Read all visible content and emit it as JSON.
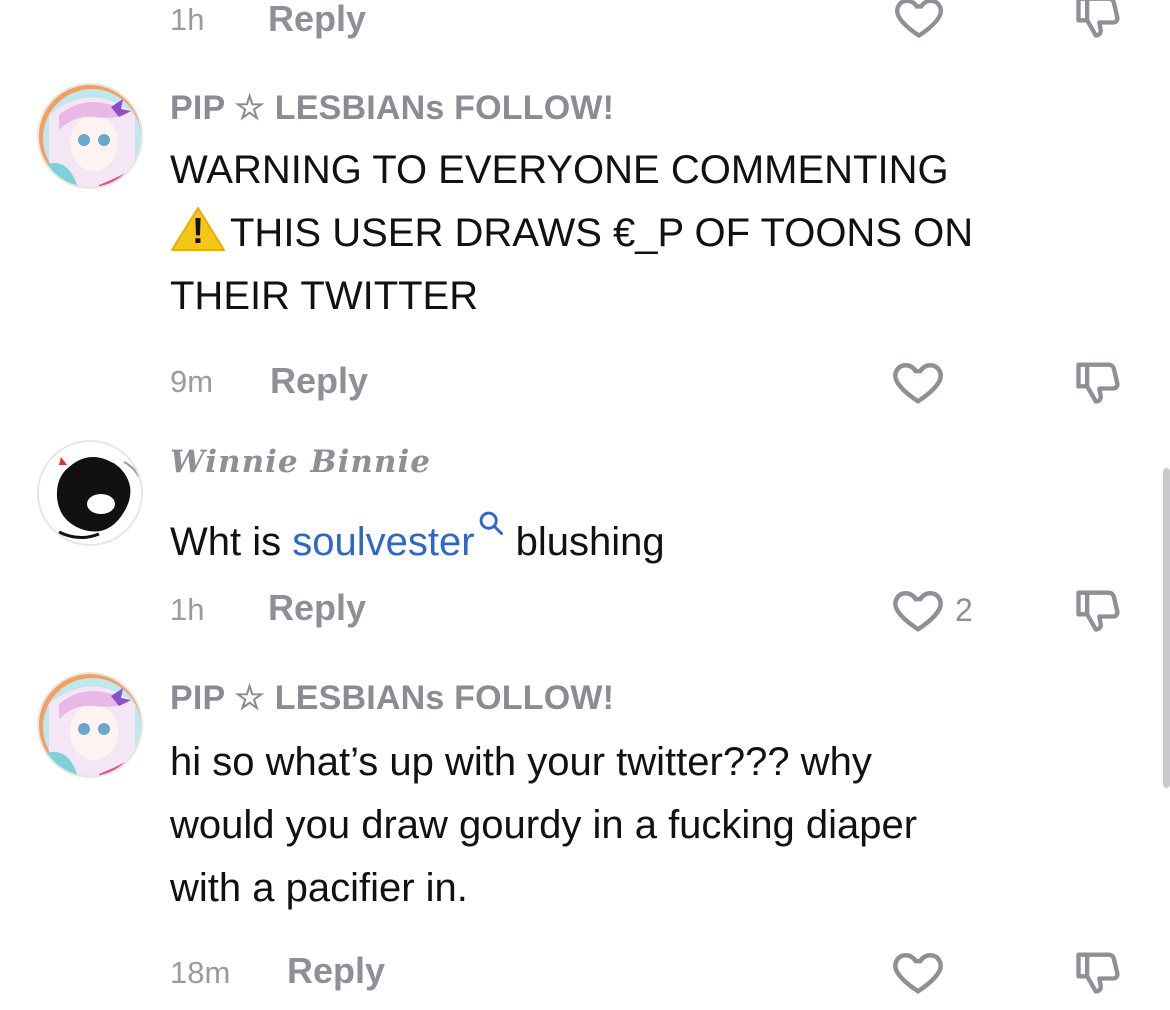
{
  "comments": [
    {
      "time": "1h",
      "reply_label": "Reply",
      "partial": true
    },
    {
      "username": "PIP ☆ LESBIANs FOLLOW!",
      "text_lines": [
        "WARNING TO EVERYONE COMMENTING",
        "THIS USER DRAWS €_P OF TOONS ON",
        "THEIR TWITTER"
      ],
      "warning_glyph": "!",
      "time": "9m",
      "reply_label": "Reply"
    },
    {
      "username": "Winnie Binnie",
      "text_before": "Wht is ",
      "mention": "soulvester",
      "text_after": " blushing",
      "time": "1h",
      "reply_label": "Reply",
      "like_count": "2"
    },
    {
      "username": "PIP ☆ LESBIANs FOLLOW!",
      "text_lines": [
        "hi so what’s up with your twitter??? why",
        "would you draw gourdy in a fucking diaper",
        "with a pacifier in."
      ],
      "time": "18m",
      "reply_label": "Reply"
    }
  ],
  "icons": {
    "like": "heart-outline-icon",
    "dislike": "thumbs-down-icon",
    "mention_search": "search-icon",
    "warning": "warning-icon"
  },
  "colors": {
    "mention": "#2e66c9",
    "meta": "#8f8f98",
    "warning_yellow": "#f5c518"
  }
}
